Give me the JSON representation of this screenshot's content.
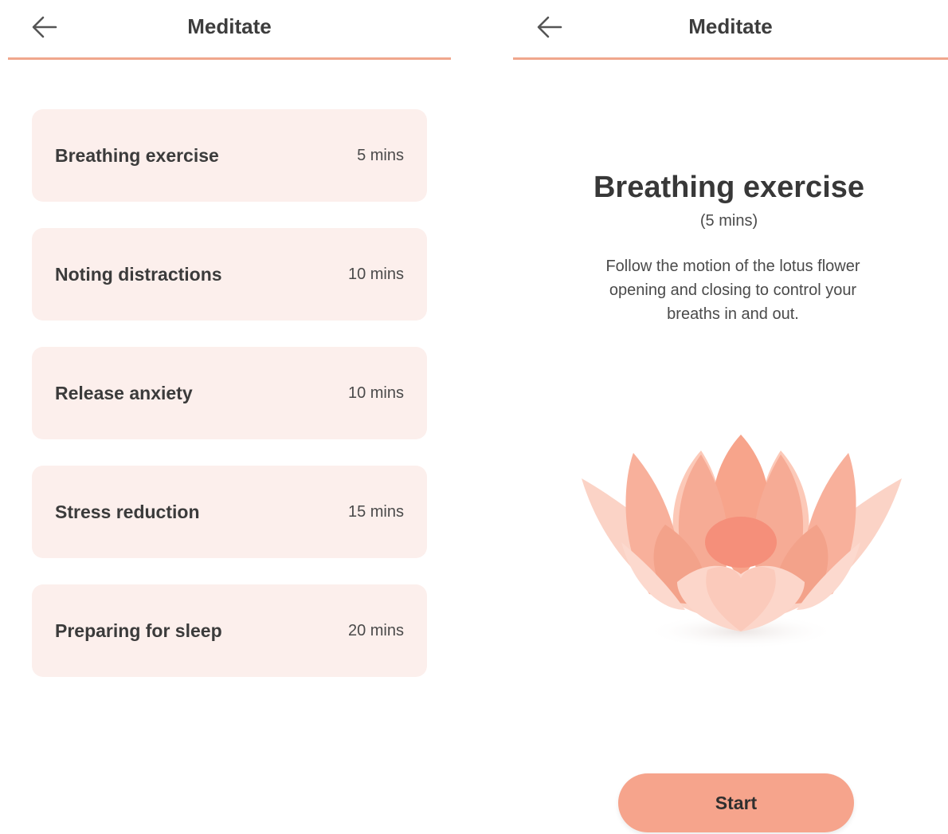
{
  "list_screen": {
    "header": {
      "title": "Meditate",
      "back_icon": "arrow-left-icon"
    },
    "items": [
      {
        "title": "Breathing exercise",
        "duration": "5 mins"
      },
      {
        "title": "Noting distractions",
        "duration": "10 mins"
      },
      {
        "title": "Release anxiety",
        "duration": "10 mins"
      },
      {
        "title": "Stress reduction",
        "duration": "15 mins"
      },
      {
        "title": "Preparing for sleep",
        "duration": "20 mins"
      }
    ]
  },
  "detail_screen": {
    "header": {
      "title": "Meditate",
      "back_icon": "arrow-left-icon"
    },
    "title": "Breathing exercise",
    "duration": "(5 mins)",
    "description": "Follow the motion of the lotus flower opening and closing to control your breaths in and out.",
    "illustration_icon": "lotus-flower-icon",
    "start_label": "Start"
  },
  "colors": {
    "accent": "#f0a78d",
    "button": "#f6a48c",
    "card_background": "#fcefec",
    "text": "#3a3a3a"
  }
}
